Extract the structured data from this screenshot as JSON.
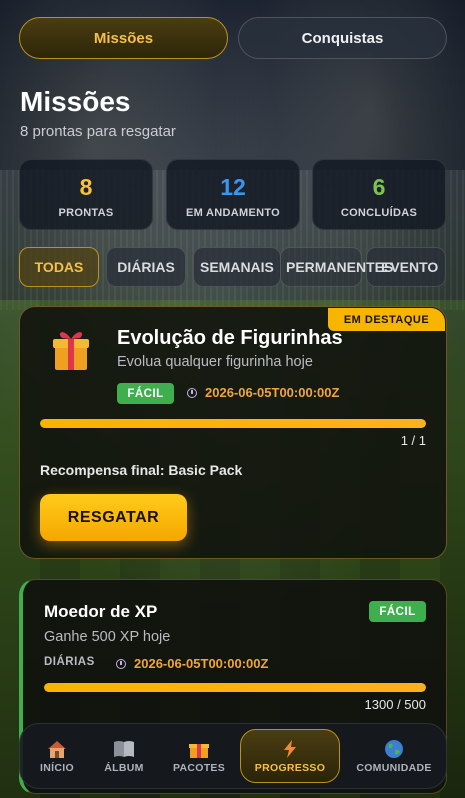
{
  "top_tabs": [
    {
      "label": "Missões",
      "active": true
    },
    {
      "label": "Conquistas",
      "active": false
    }
  ],
  "page": {
    "title": "Missões",
    "subtitle": "8 prontas para resgatar"
  },
  "stats": [
    {
      "value": "8",
      "label": "PRONTAS",
      "color": "#f7c234"
    },
    {
      "value": "12",
      "label": "EM ANDAMENTO",
      "color": "#3a97f0"
    },
    {
      "value": "6",
      "label": "CONCLUÍDAS",
      "color": "#7cc44e"
    }
  ],
  "filters": [
    {
      "label": "TODAS",
      "active": true
    },
    {
      "label": "DIÁRIAS",
      "active": false
    },
    {
      "label": "SEMANAIS",
      "active": false
    },
    {
      "label": "PERMANENTES",
      "active": false
    },
    {
      "label": "EVENTO",
      "active": false
    }
  ],
  "featured_mission": {
    "badge": "EM DESTAQUE",
    "icon": "gift-icon",
    "title": "Evolução de Figurinhas",
    "description": "Evolua qualquer figurinha hoje",
    "difficulty": "FÁCIL",
    "deadline": "2026-06-05T00:00:00Z",
    "progress_text": "1 / 1",
    "progress_fraction": 1.0,
    "reward_text": "Recompensa final: Basic Pack",
    "claim_label": "RESGATAR"
  },
  "mission_2": {
    "title": "Moedor de XP",
    "description": "Ganhe 500 XP hoje",
    "category": "DIÁRIAS",
    "difficulty": "FÁCIL",
    "deadline": "2026-06-05T00:00:00Z",
    "progress_text": "1300 / 500",
    "progress_fraction": 1.0,
    "accent_color": "#3fae4f"
  },
  "bottom_nav": [
    {
      "label": "INÍCIO",
      "icon": "home-icon",
      "active": false
    },
    {
      "label": "ÁLBUM",
      "icon": "album-icon",
      "active": false
    },
    {
      "label": "PACOTES",
      "icon": "gift-icon",
      "active": false
    },
    {
      "label": "PROGRESSO",
      "icon": "lightning-icon",
      "active": true
    },
    {
      "label": "COMUNIDADE",
      "icon": "globe-icon",
      "active": false
    }
  ],
  "colors": {
    "accent_gold": "#f7b500",
    "easy_green": "#3fae4f",
    "deadline_orange": "#f0a63a"
  }
}
